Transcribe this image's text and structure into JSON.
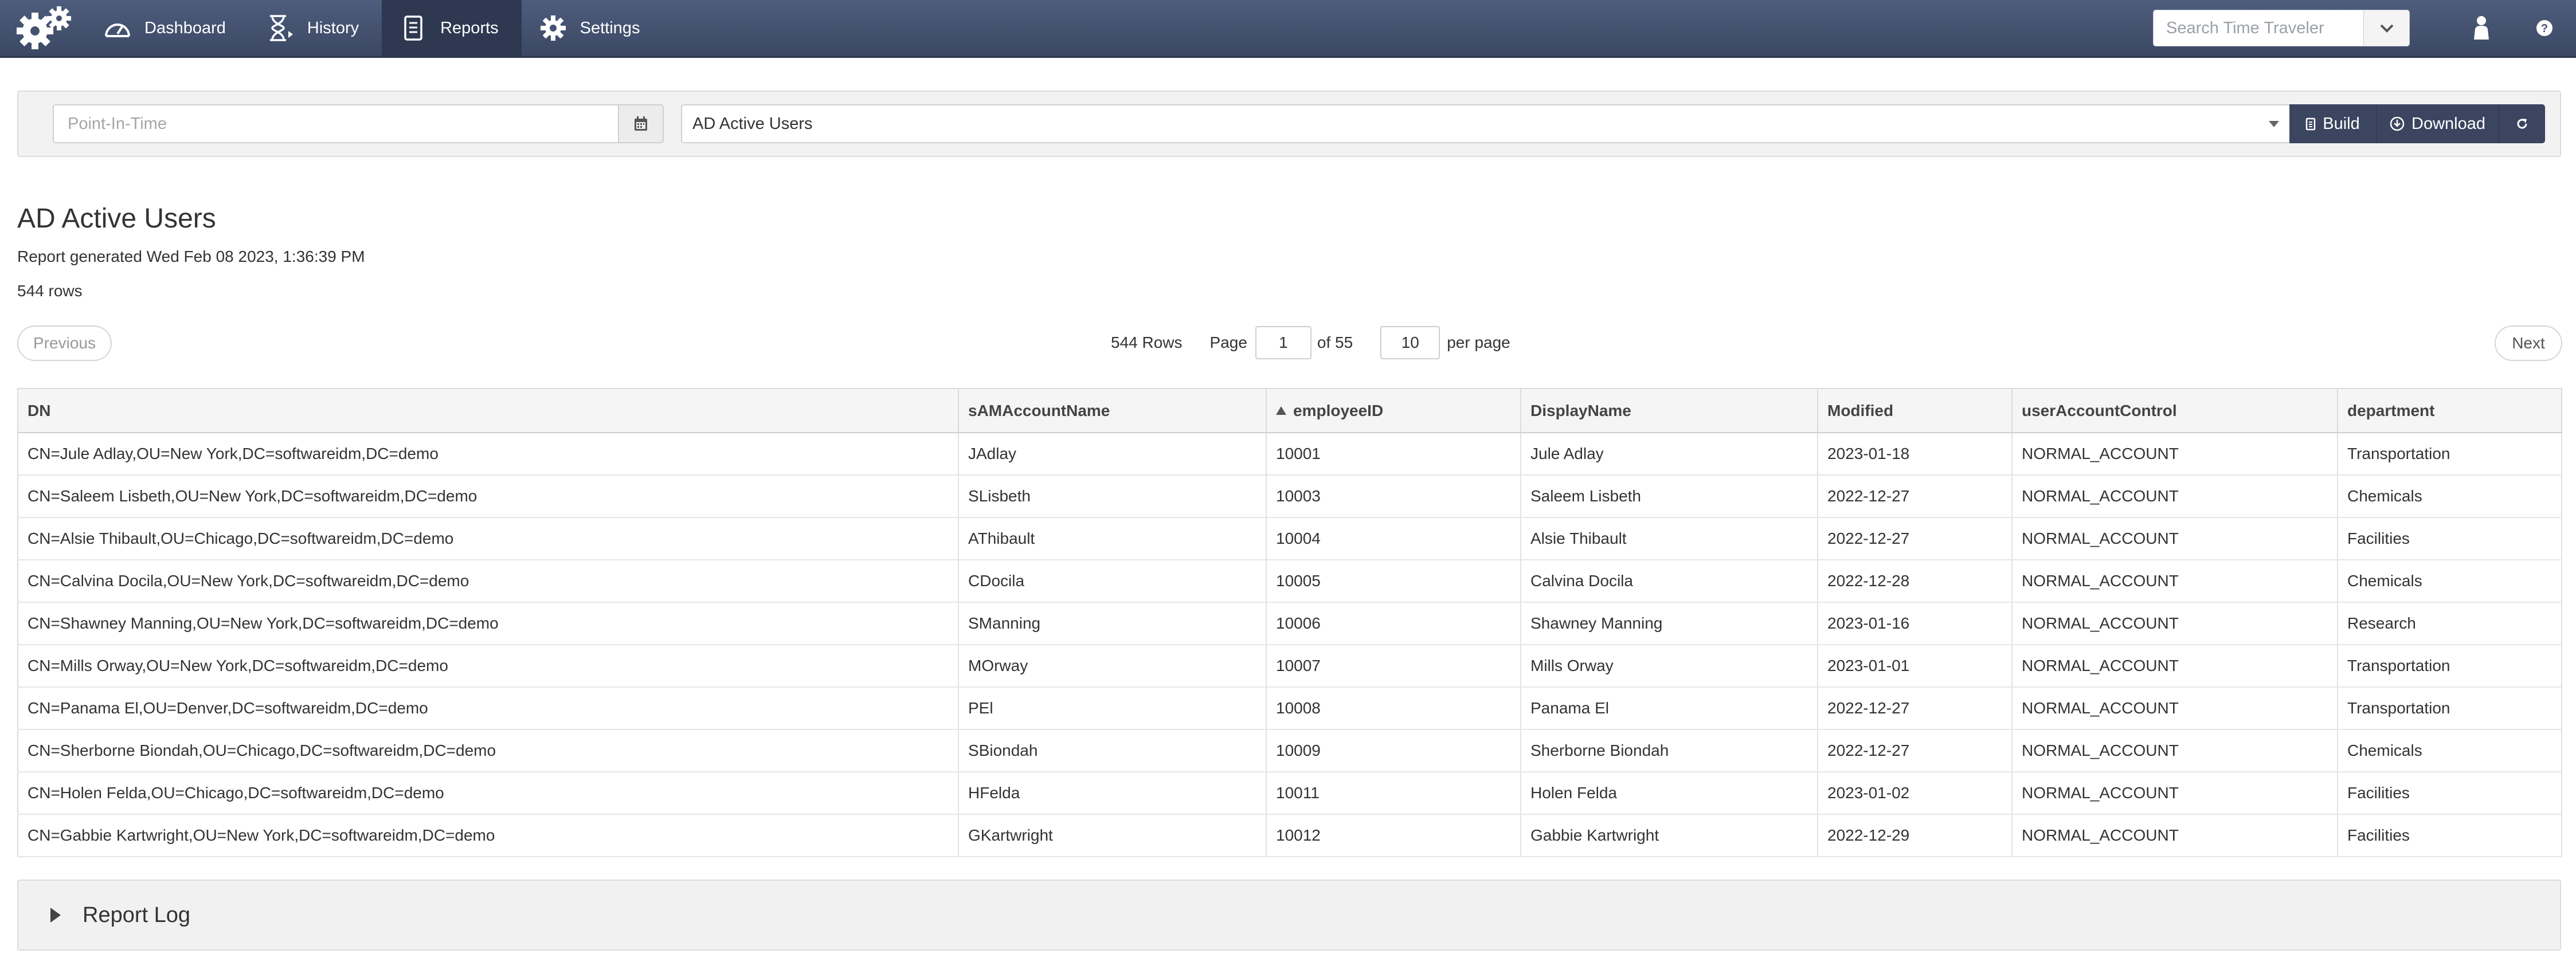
{
  "nav": {
    "items": [
      {
        "label": "Dashboard",
        "icon": "dashboard-gauge-icon",
        "active": false
      },
      {
        "label": "History",
        "icon": "hourglass-icon",
        "active": false
      },
      {
        "label": "Reports",
        "icon": "report-document-icon",
        "active": true
      },
      {
        "label": "Settings",
        "icon": "gear-icon",
        "active": false
      }
    ],
    "search_placeholder": "Search Time Traveler",
    "brand_color": "#44526f"
  },
  "toolbar": {
    "pit_placeholder": "Point-In-Time",
    "selected_report": "AD Active Users",
    "build_label": "Build",
    "download_label": "Download"
  },
  "report": {
    "title": "AD Active Users",
    "generated": "Report generated Wed Feb 08 2023, 1:36:39 PM",
    "rows_text": "544 rows"
  },
  "pager": {
    "previous_label": "Previous",
    "next_label": "Next",
    "rows_label": "544 Rows",
    "page_label": "Page",
    "page_value": "1",
    "of_label": "of 55",
    "per_page_value": "10",
    "per_page_label": "per page"
  },
  "table": {
    "columns": [
      "DN",
      "sAMAccountName",
      "employeeID",
      "DisplayName",
      "Modified",
      "userAccountControl",
      "department"
    ],
    "sorted_column": "employeeID",
    "rows": [
      [
        "CN=Jule Adlay,OU=New York,DC=softwareidm,DC=demo",
        "JAdlay",
        "10001",
        "Jule Adlay",
        "2023-01-18",
        "NORMAL_ACCOUNT",
        "Transportation"
      ],
      [
        "CN=Saleem Lisbeth,OU=New York,DC=softwareidm,DC=demo",
        "SLisbeth",
        "10003",
        "Saleem Lisbeth",
        "2022-12-27",
        "NORMAL_ACCOUNT",
        "Chemicals"
      ],
      [
        "CN=Alsie Thibault,OU=Chicago,DC=softwareidm,DC=demo",
        "AThibault",
        "10004",
        "Alsie Thibault",
        "2022-12-27",
        "NORMAL_ACCOUNT",
        "Facilities"
      ],
      [
        "CN=Calvina Docila,OU=New York,DC=softwareidm,DC=demo",
        "CDocila",
        "10005",
        "Calvina Docila",
        "2022-12-28",
        "NORMAL_ACCOUNT",
        "Chemicals"
      ],
      [
        "CN=Shawney Manning,OU=New York,DC=softwareidm,DC=demo",
        "SManning",
        "10006",
        "Shawney Manning",
        "2023-01-16",
        "NORMAL_ACCOUNT",
        "Research"
      ],
      [
        "CN=Mills Orway,OU=New York,DC=softwareidm,DC=demo",
        "MOrway",
        "10007",
        "Mills Orway",
        "2023-01-01",
        "NORMAL_ACCOUNT",
        "Transportation"
      ],
      [
        "CN=Panama El,OU=Denver,DC=softwareidm,DC=demo",
        "PEl",
        "10008",
        "Panama El",
        "2022-12-27",
        "NORMAL_ACCOUNT",
        "Transportation"
      ],
      [
        "CN=Sherborne Biondah,OU=Chicago,DC=softwareidm,DC=demo",
        "SBiondah",
        "10009",
        "Sherborne Biondah",
        "2022-12-27",
        "NORMAL_ACCOUNT",
        "Chemicals"
      ],
      [
        "CN=Holen Felda,OU=Chicago,DC=softwareidm,DC=demo",
        "HFelda",
        "10011",
        "Holen Felda",
        "2023-01-02",
        "NORMAL_ACCOUNT",
        "Facilities"
      ],
      [
        "CN=Gabbie Kartwright,OU=New York,DC=softwareidm,DC=demo",
        "GKartwright",
        "10012",
        "Gabbie Kartwright",
        "2022-12-29",
        "NORMAL_ACCOUNT",
        "Facilities"
      ]
    ]
  },
  "log": {
    "label": "Report Log"
  }
}
